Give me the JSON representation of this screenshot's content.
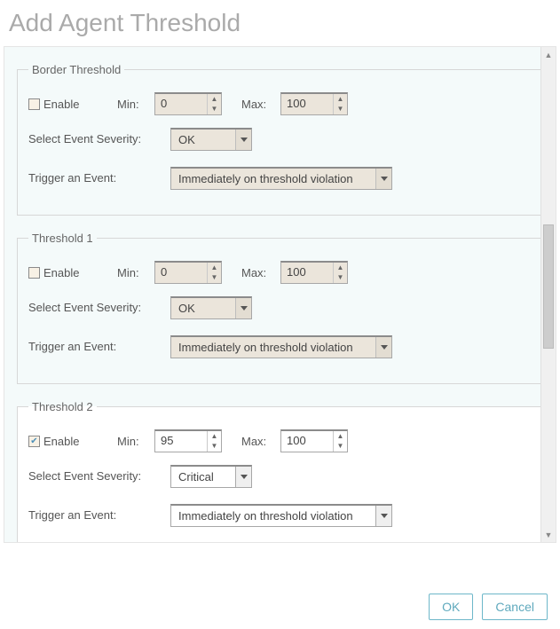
{
  "title": "Add Agent Threshold",
  "labels": {
    "enable": "Enable",
    "min": "Min:",
    "max": "Max:",
    "severity": "Select Event Severity:",
    "trigger": "Trigger an Event:"
  },
  "groups": [
    {
      "legend": "Border Threshold",
      "enabled": false,
      "min": "0",
      "max": "100",
      "severity": "OK",
      "trigger": "Immediately on threshold violation",
      "active": false
    },
    {
      "legend": "Threshold 1",
      "enabled": false,
      "min": "0",
      "max": "100",
      "severity": "OK",
      "trigger": "Immediately on threshold violation",
      "active": false
    },
    {
      "legend": "Threshold 2",
      "enabled": true,
      "min": "95",
      "max": "100",
      "severity": "Critical",
      "trigger": "Immediately on threshold violation",
      "active": true
    }
  ],
  "buttons": {
    "ok": "OK",
    "cancel": "Cancel"
  }
}
